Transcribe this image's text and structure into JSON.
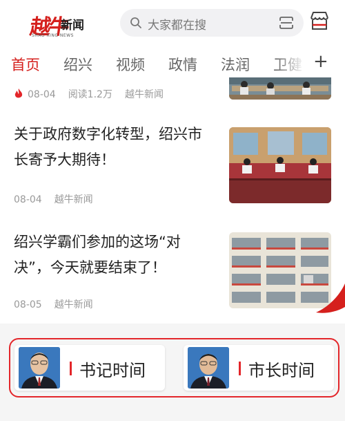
{
  "header": {
    "logo_main": "越牛",
    "logo_sub": "新闻",
    "logo_en": "SHAO XING NEWS",
    "search_placeholder": "大家都在搜",
    "icons": [
      "search-icon",
      "scan-icon",
      "store-icon"
    ]
  },
  "tabs": [
    {
      "label": "首页",
      "active": true
    },
    {
      "label": "绍兴"
    },
    {
      "label": "视频"
    },
    {
      "label": "政情"
    },
    {
      "label": "法润"
    },
    {
      "label": "卫健"
    }
  ],
  "tab_plus": "+",
  "articles": [
    {
      "date": "08-04",
      "reads": "阅读1.2万",
      "source": "越牛新闻",
      "hot": true
    },
    {
      "title": "关于政府数字化转型，绍兴市长寄予大期待！",
      "date": "08-04",
      "source": "越牛新闻"
    },
    {
      "title": "绍兴学霸们参加的这场“对决”，今天就要结束了！",
      "date": "08-05",
      "source": "越牛新闻"
    }
  ],
  "entries": {
    "secretary": "书记时间",
    "mayor": "市长时间"
  },
  "colors": {
    "accent": "#d5201d",
    "frame": "#e3262a"
  }
}
